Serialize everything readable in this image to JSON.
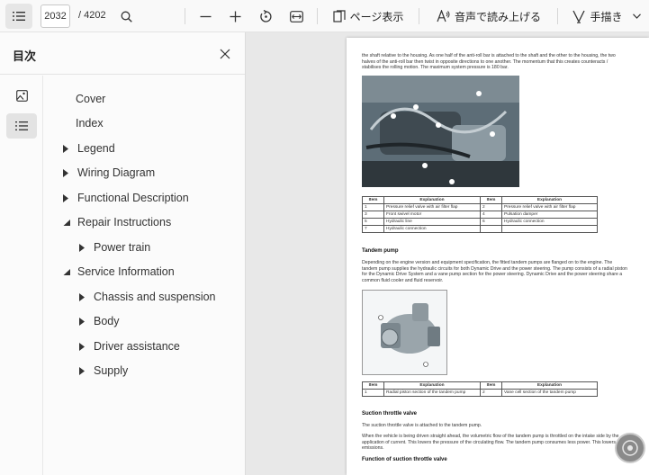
{
  "toolbar": {
    "page_current": "2032",
    "page_total": "/ 4202",
    "page_view_label": "ページ表示",
    "read_aloud_label": "音声で読み上げる",
    "draw_label": "手描き"
  },
  "sidebar": {
    "title": "目次",
    "toc": [
      {
        "label": "Cover"
      },
      {
        "label": "Index"
      },
      {
        "label": "Legend"
      },
      {
        "label": "Wiring Diagram"
      },
      {
        "label": "Functional Description"
      },
      {
        "label": "Repair Instructions"
      },
      {
        "label": "Power train"
      },
      {
        "label": "Service Information"
      },
      {
        "label": "Chassis and suspension"
      },
      {
        "label": "Body"
      },
      {
        "label": "Driver assistance"
      },
      {
        "label": "Supply"
      }
    ]
  },
  "document": {
    "intro": "the shaft relative to the housing. As one half of the anti-roll bar is attached to the shaft and the other to the housing, the two halves of the anti-roll bar then twist in opposite directions to one another. The momentum that this creates counteracts / stabilises the rolling motion. The maximum system pressure is 180 bar.",
    "table1": {
      "headers": [
        "Item",
        "Explanation",
        "Item",
        "Explanation"
      ],
      "rows": [
        [
          "1",
          "Pressure relief valve with air filter flap",
          "2",
          "Pressure relief valve with air filter flap"
        ],
        [
          "3",
          "Front swivel motor",
          "4",
          "Pulsation damper"
        ],
        [
          "5",
          "Hydraulic line",
          "6",
          "Hydraulic connection"
        ],
        [
          "7",
          "Hydraulic connection",
          "",
          ""
        ]
      ]
    },
    "heading_tandem": "Tandem pump",
    "para_tandem": "Depending on the engine version and equipment specification, the fitted tandem pumps are flanged on to the engine. The tandem pump supplies the hydraulic circuits for both Dynamic Drive and the power steering. The pump consists of a radial piston for the Dynamic Drive System and a vane pump section for the power steering. Dynamic Drive and the power steering share a common fluid cooler and fluid reservoir.",
    "table2": {
      "headers": [
        "Item",
        "Explanation",
        "Item",
        "Explanation"
      ],
      "rows": [
        [
          "1",
          "Radial piston section of the tandem pump",
          "2",
          "Vane cell section of the tandem pump"
        ]
      ]
    },
    "heading_suction": "Suction throttle valve",
    "para_suction1": "The suction throttle valve is attached to the tandem pump.",
    "para_suction2": "When the vehicle is being driven straight ahead, the volumetric flow of the tandem pump is throttled on the intake side by the application of current. This lowers the pressure of the circulating flow. The tandem pump consumes less power. This lowers CO2 emissions.",
    "heading_function": "Function of suction throttle valve"
  }
}
